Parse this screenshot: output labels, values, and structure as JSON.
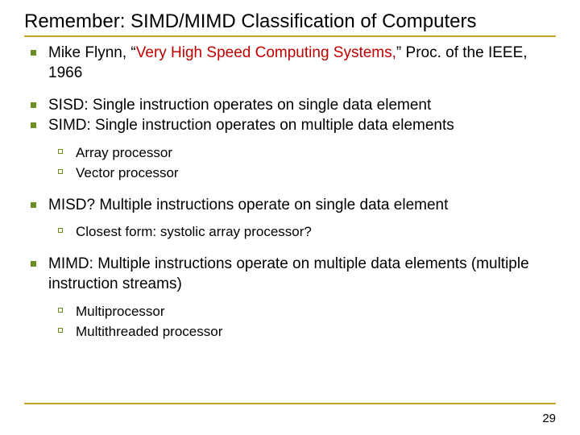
{
  "title": "Remember: SIMD/MIMD Classification of Computers",
  "bullets": {
    "b1_pre": "Mike Flynn, “",
    "b1_red": "Very High Speed Computing Systems,",
    "b1_post": "” Proc. of the IEEE, 1966",
    "b2": "SISD: Single instruction operates on single data element",
    "b3": "SIMD: Single instruction operates on multiple data elements",
    "b3_sub1": "Array processor",
    "b3_sub2": "Vector processor",
    "b4": "MISD? Multiple instructions operate on single data element",
    "b4_sub1": "Closest form: systolic array processor?",
    "b5": "MIMD: Multiple instructions operate on multiple data elements (multiple instruction streams)",
    "b5_sub1": "Multiprocessor",
    "b5_sub2": "Multithreaded processor"
  },
  "page_number": "29"
}
